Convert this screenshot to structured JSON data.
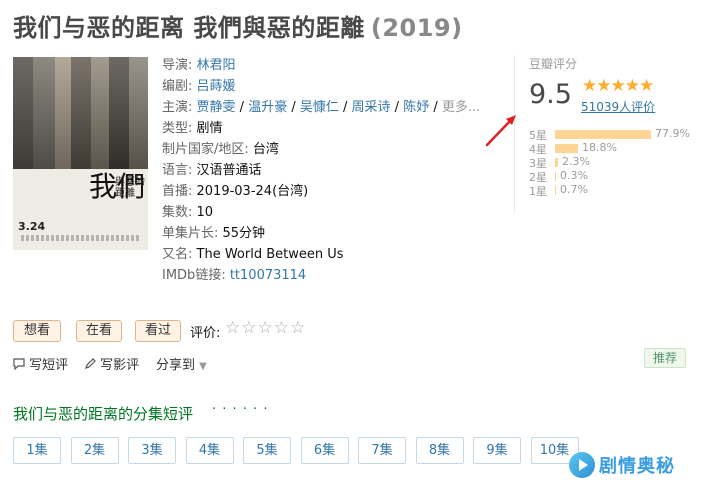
{
  "title": {
    "main": "我们与恶的距离 我們與惡的距離",
    "year": "(2019)"
  },
  "poster": {
    "date_text": "3.24",
    "calli_text": "我們",
    "sub_text": "與惡的距離"
  },
  "info": {
    "director_label": "导演: ",
    "director": "林君阳",
    "writer_label": "编剧: ",
    "writer": "吕蒔媛",
    "cast_label": "主演: ",
    "cast": [
      "贾静雯",
      "温升豪",
      "吴慷仁",
      "周采诗",
      "陈妤"
    ],
    "cast_more": "更多...",
    "genre_label": "类型: ",
    "genre": "剧情",
    "country_label": "制片国家/地区: ",
    "country": "台湾",
    "language_label": "语言: ",
    "language": "汉语普通话",
    "premiere_label": "首播: ",
    "premiere": "2019-03-24(台湾)",
    "episodes_label": "集数: ",
    "episodes": "10",
    "runtime_label": "单集片长: ",
    "runtime": "55分钟",
    "aka_label": "又名: ",
    "aka": "The World Between Us",
    "imdb_label": "IMDb链接: ",
    "imdb": "tt10073114"
  },
  "rating": {
    "heading": "豆瓣评分",
    "score": "9.5",
    "stars": "★★★★★",
    "people": "51039人评价",
    "distribution": [
      {
        "star": "5星",
        "pct": "77.9%",
        "value": 77.9
      },
      {
        "star": "4星",
        "pct": "18.8%",
        "value": 18.8
      },
      {
        "star": "3星",
        "pct": "2.3%",
        "value": 2.3
      },
      {
        "star": "2星",
        "pct": "0.3%",
        "value": 0.3
      },
      {
        "star": "1星",
        "pct": "0.7%",
        "value": 0.7
      }
    ]
  },
  "actions": {
    "want": "想看",
    "watching": "在看",
    "watched": "看过",
    "rate_label": "评价:",
    "rate_stars": "☆☆☆☆☆"
  },
  "social": {
    "short_review": "写短评",
    "review": "写影评",
    "share": "分享到",
    "recommend": "推荐"
  },
  "episodes_section": {
    "title": "我们与恶的距离的分集短评",
    "dots": "· · · · · ·",
    "items": [
      "1集",
      "2集",
      "3集",
      "4集",
      "5集",
      "6集",
      "7集",
      "8集",
      "9集",
      "10集"
    ]
  },
  "watermark": {
    "text": "剧情奥秘"
  },
  "colors": {
    "link": "#3377aa",
    "star": "#ffac2d",
    "bar": "#ffd596",
    "section_green": "#007722",
    "arrow": "#e02020"
  }
}
